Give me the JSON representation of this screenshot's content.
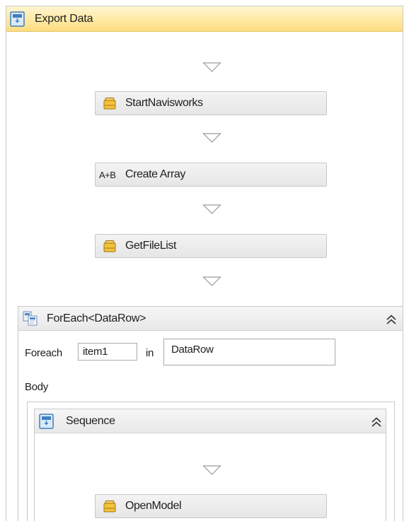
{
  "workflow": {
    "title": "Export Data",
    "activities": [
      {
        "label": "StartNavisworks",
        "icon": "invoke-method-icon"
      },
      {
        "label": "Create Array",
        "icon": "assign-icon",
        "icon_text": "A+B"
      },
      {
        "label": "GetFileList",
        "icon": "invoke-method-icon"
      }
    ],
    "foreach": {
      "title": "ForEach<DataRow>",
      "foreach_label": "Foreach",
      "item_value": "item1",
      "in_label": "in",
      "collection_value": "DataRow",
      "body_label": "Body",
      "sequence": {
        "title": "Sequence",
        "activities": [
          {
            "label": "OpenModel",
            "icon": "invoke-method-icon"
          }
        ]
      }
    }
  },
  "colors": {
    "header_yellow": "#fde08a",
    "icon_blue": "#3f7fc1",
    "icon_gold": "#e5a21a",
    "border": "#c9c9c9"
  }
}
